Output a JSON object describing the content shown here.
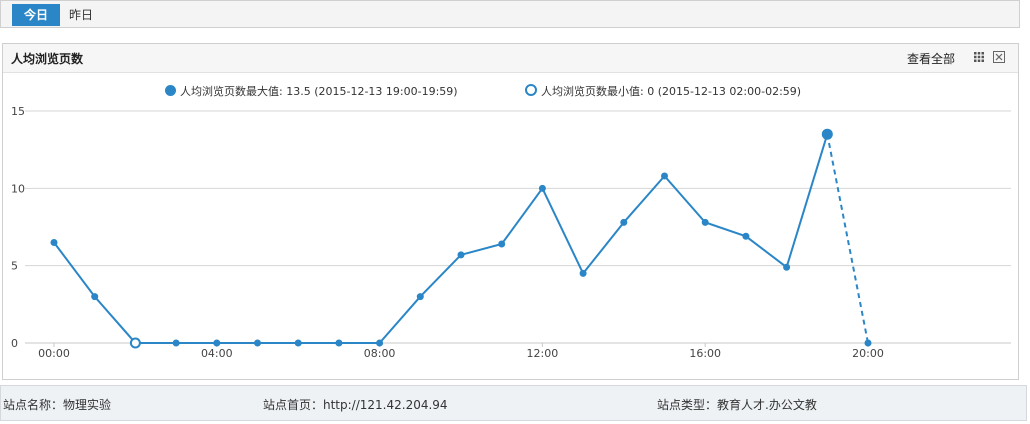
{
  "tabs": [
    {
      "label": "今日",
      "active": true
    },
    {
      "label": "昨日",
      "active": false
    }
  ],
  "panel": {
    "title": "人均浏览页数",
    "view_all": "查看全部",
    "icons": {
      "grid": "grid-icon",
      "close": "close-box-icon"
    }
  },
  "legend": {
    "max_label": "人均浏览页数最大值: 13.5 (2015-12-13 19:00-19:59)",
    "min_label": "人均浏览页数最小值: 0 (2015-12-13 02:00-02:59)"
  },
  "chart_data": {
    "type": "line",
    "accent": "#2a86c7",
    "ylim": [
      0,
      15
    ],
    "yticks": [
      "0",
      "5",
      "10",
      "15"
    ],
    "xticks": [
      {
        "hour": 0,
        "label": "00:00"
      },
      {
        "hour": 4,
        "label": "04:00"
      },
      {
        "hour": 8,
        "label": "08:00"
      },
      {
        "hour": 12,
        "label": "12:00"
      },
      {
        "hour": 16,
        "label": "16:00"
      },
      {
        "hour": 20,
        "label": "20:00"
      }
    ],
    "series": [
      {
        "hours": [
          0,
          1,
          2,
          3,
          4,
          5,
          6,
          7,
          8,
          9,
          10,
          11,
          12,
          13,
          14,
          15,
          16,
          17,
          18,
          19,
          20
        ],
        "values": [
          6.5,
          3.0,
          0,
          0,
          0,
          0,
          0,
          0,
          0,
          3.0,
          5.7,
          6.4,
          10.0,
          4.5,
          7.8,
          10.8,
          7.8,
          6.9,
          4.9,
          13.5,
          0
        ]
      }
    ],
    "max_index": 19,
    "min_index": 2,
    "dashed_last_segment": true,
    "grid": true
  },
  "footer": {
    "site_name": "站点名称：物理实验",
    "site_home": "站点首页：http://121.42.204.94",
    "site_type": "站点类型：教育人才.办公文教"
  }
}
